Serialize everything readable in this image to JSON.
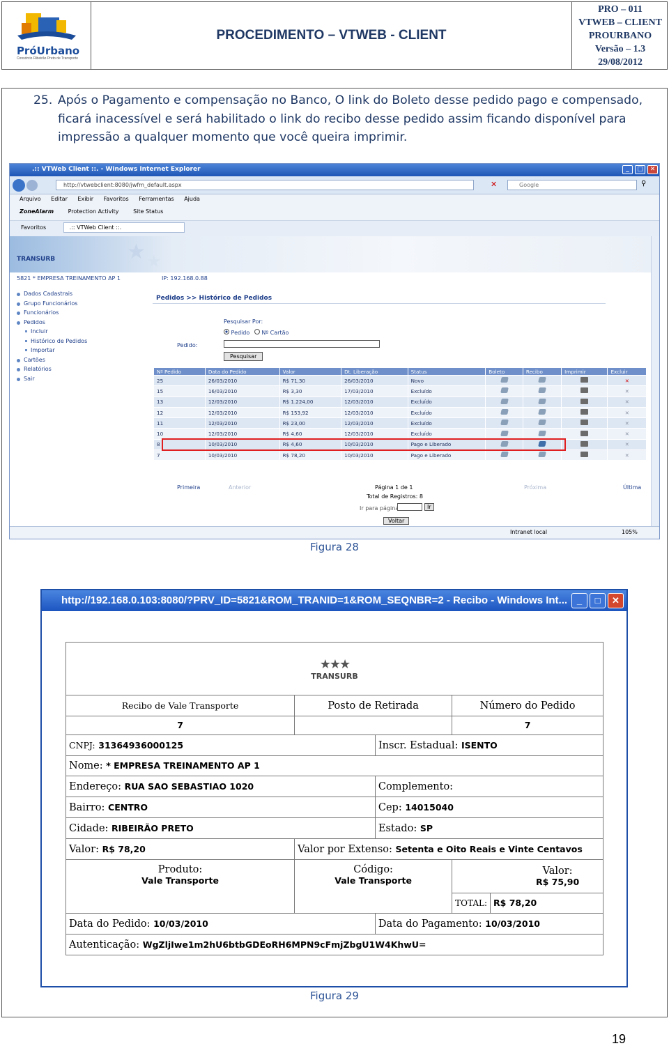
{
  "header": {
    "logo_text": "PróUrbano",
    "logo_sub": "Consórcio Ribeirão Preto de Transporte",
    "title": "PROCEDIMENTO – VTWEB - CLIENT",
    "meta": [
      "PRO – 011",
      "VTWEB – CLIENT",
      "PROURBANO",
      "Versão – 1.3",
      "29/08/2012"
    ]
  },
  "step": {
    "number": "25.",
    "text": "Após o Pagamento e compensação no Banco, O link do Boleto desse pedido pago e compensado, ficará inacessível e será habilitado o link do recibo desse pedido assim ficando disponível para impressão a qualquer momento que você queira imprimir."
  },
  "figure28": {
    "caption": "Figura 28",
    "window_title": ".:: VTWeb Client ::. - Windows Internet Explorer",
    "url": "http://vtwebclient:8080/jwfm_default.aspx",
    "search_placeholder": "Google",
    "menu": [
      "Arquivo",
      "Editar",
      "Exibir",
      "Favoritos",
      "Ferramentas",
      "Ajuda"
    ],
    "links_bar": [
      "ZoneAlarm",
      "Protection Activity",
      "Site Status"
    ],
    "fav_bar": [
      "Favoritos",
      ".:: VTWeb Client ::."
    ],
    "brand": "TRANSURB",
    "company_line": "5821   * EMPRESA TREINAMENTO AP 1",
    "ip_line": "IP: 192.168.0.88",
    "nav": [
      {
        "label": "Dados Cadastrais",
        "sub": false
      },
      {
        "label": "Grupo Funcionários",
        "sub": false
      },
      {
        "label": "Funcionários",
        "sub": false
      },
      {
        "label": "Pedidos",
        "sub": false
      },
      {
        "label": "Incluir",
        "sub": true
      },
      {
        "label": "Histórico de Pedidos",
        "sub": true
      },
      {
        "label": "Importar",
        "sub": true
      },
      {
        "label": "Cartões",
        "sub": false
      },
      {
        "label": "Relatórios",
        "sub": false
      },
      {
        "label": "Sair",
        "sub": false
      }
    ],
    "breadcrumb": "Pedidos >> Histórico de Pedidos",
    "search_by_label": "Pesquisar Por:",
    "radio_pedido": "Pedido",
    "radio_cartao": "Nº Cartão",
    "pedido_label": "Pedido:",
    "search_button": "Pesquisar",
    "columns": [
      "Nº Pedido",
      "Data do Pedido",
      "Valor",
      "Dt. Liberação",
      "Status",
      "Boleto",
      "Recibo",
      "Imprimir",
      "Excluir"
    ],
    "rows": [
      {
        "num": "25",
        "data": "26/03/2010",
        "valor": "R$ 71,30",
        "lib": "26/03/2010",
        "status": "Novo",
        "recibo": false,
        "red_x": true
      },
      {
        "num": "15",
        "data": "16/03/2010",
        "valor": "R$ 3,30",
        "lib": "17/03/2010",
        "status": "Excluído",
        "recibo": false,
        "red_x": false
      },
      {
        "num": "13",
        "data": "12/03/2010",
        "valor": "R$ 1.224,00",
        "lib": "12/03/2010",
        "status": "Excluído",
        "recibo": false,
        "red_x": false
      },
      {
        "num": "12",
        "data": "12/03/2010",
        "valor": "R$ 153,92",
        "lib": "12/03/2010",
        "status": "Excluído",
        "recibo": false,
        "red_x": false
      },
      {
        "num": "11",
        "data": "12/03/2010",
        "valor": "R$ 23,00",
        "lib": "12/03/2010",
        "status": "Excluído",
        "recibo": false,
        "red_x": false
      },
      {
        "num": "10",
        "data": "12/03/2010",
        "valor": "R$ 4,60",
        "lib": "12/03/2010",
        "status": "Excluído",
        "recibo": false,
        "red_x": false
      },
      {
        "num": "8",
        "data": "10/03/2010",
        "valor": "R$ 4,60",
        "lib": "10/03/2010",
        "status": "Pago e Liberado",
        "recibo": true,
        "red_x": false
      },
      {
        "num": "7",
        "data": "10/03/2010",
        "valor": "R$ 78,20",
        "lib": "10/03/2010",
        "status": "Pago e Liberado",
        "recibo": false,
        "red_x": false
      }
    ],
    "pager": {
      "first": "Primeira",
      "prev": "Anterior",
      "next": "Próxima",
      "last": "Última",
      "page_info": "Página 1 de 1",
      "total": "Total de Registros: 8",
      "goto_label": "Ir para página:",
      "goto_button": "Ir",
      "back_button": "Voltar"
    },
    "status_zone": "Intranet local",
    "zoom": "105%"
  },
  "figure29": {
    "caption": "Figura 29",
    "window_title": "http://192.168.0.103:8080/?PRV_ID=5821&ROM_TRANID=1&ROM_SEQNBR=2 - Recibo - Windows Int...",
    "brand": "TRANSURB",
    "col1_header": "Recibo de Vale Transporte",
    "col2_header": "Posto de Retirada",
    "col3_header": "Número do Pedido",
    "col1_value": "7",
    "col3_value": "7",
    "cnpj_label": "CNPJ:",
    "cnpj": "31364936000125",
    "ie_label": "Inscr. Estadual:",
    "ie": "ISENTO",
    "nome_label": "Nome:",
    "nome": "* EMPRESA TREINAMENTO AP 1",
    "end_label": "Endereço:",
    "end": "RUA SAO SEBASTIAO 1020",
    "compl_label": "Complemento:",
    "compl": "",
    "bairro_label": "Bairro:",
    "bairro": "CENTRO",
    "cep_label": "Cep:",
    "cep": "14015040",
    "cidade_label": "Cidade:",
    "cidade": "RIBEIRÃO PRETO",
    "estado_label": "Estado:",
    "estado": "SP",
    "valor_label": "Valor:",
    "valor": "R$ 78,20",
    "extenso_label": "Valor por Extenso:",
    "extenso": "Setenta e Oito Reais e Vinte Centavos",
    "produto_label": "Produto:",
    "produto": "Vale Transporte",
    "codigo_label": "Código:",
    "codigo": "Vale Transporte",
    "valor2_label": "Valor:",
    "valor2": "R$ 75,90",
    "total_label": "TOTAL:",
    "total": "R$ 78,20",
    "dped_label": "Data do Pedido:",
    "dped": "10/03/2010",
    "dpag_label": "Data do Pagamento:",
    "dpag": "10/03/2010",
    "aut_label": "Autenticação:",
    "aut": "WgZljIwe1m2hU6btbGDEoRH6MPN9cFmjZbgU1W4KhwU="
  },
  "page_number": "19"
}
